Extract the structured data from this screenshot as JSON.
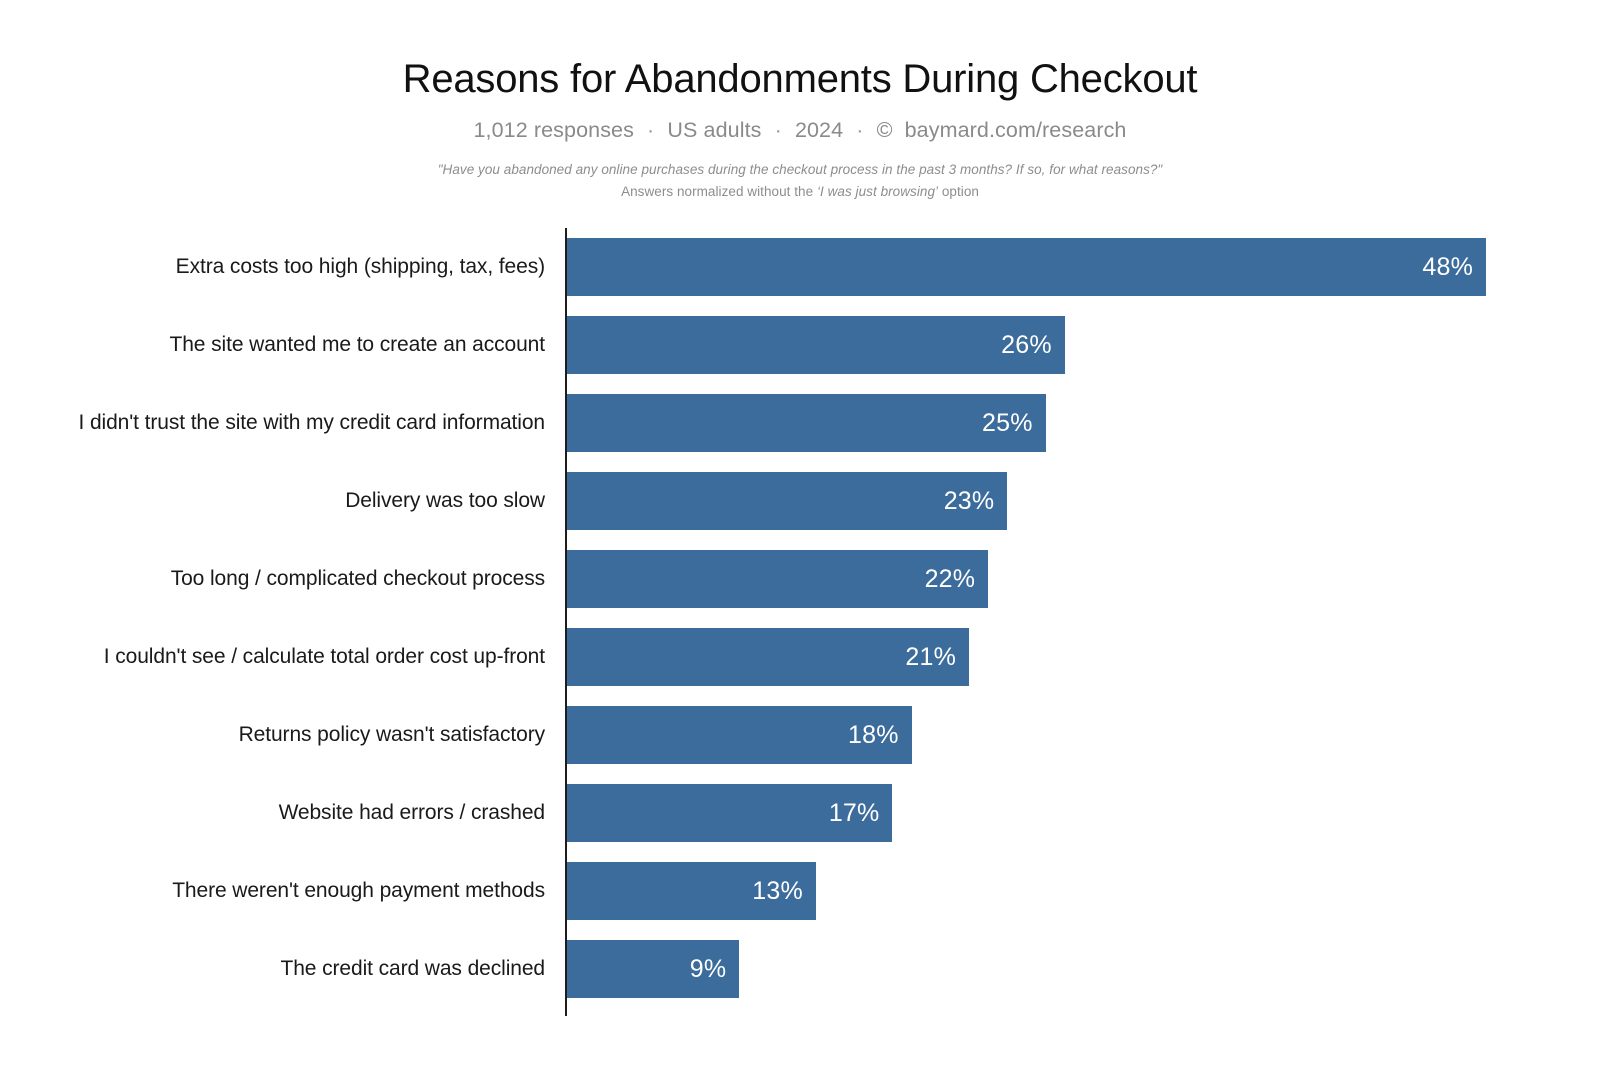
{
  "header": {
    "title": "Reasons for Abandonments During Checkout",
    "responses": "1,012 responses",
    "audience": "US adults",
    "year": "2024",
    "copyright_symbol": "©",
    "source": "baymard.com/research",
    "separator": "·",
    "question": "\"Have you abandoned any online purchases during the checkout process in the past 3 months? If so, for what reasons?\"",
    "note_prefix": "Answers normalized without the ",
    "note_emphasis": "‘I was just browsing’",
    "note_suffix": " option"
  },
  "colors": {
    "bar": "#3b6c9c",
    "bar_value_text": "#ffffff",
    "category_text": "#1a1a1a",
    "subtitle_text": "#8a8a8a",
    "axis": "#1d1d1d",
    "background": "#ffffff"
  },
  "chart_data": {
    "type": "bar",
    "orientation": "horizontal",
    "title": "Reasons for Abandonments During Checkout",
    "subtitle": "1,012 responses · US adults · 2024 · © baymard.com/research",
    "xlabel": "",
    "ylabel": "",
    "xlim": [
      0,
      48
    ],
    "grid": false,
    "legend": null,
    "value_suffix": "%",
    "categories": [
      "Extra costs too high (shipping, tax, fees)",
      "The site wanted me to create an account",
      "I didn't trust the site with my credit card information",
      "Delivery was too slow",
      "Too long / complicated checkout process",
      "I couldn't see / calculate total order cost up-front",
      "Returns policy wasn't satisfactory",
      "Website had errors / crashed",
      "There weren't enough payment methods",
      "The credit card was declined"
    ],
    "values": [
      48,
      26,
      25,
      23,
      22,
      21,
      18,
      17,
      13,
      9
    ],
    "value_labels": [
      "48%",
      "26%",
      "25%",
      "23%",
      "22%",
      "21%",
      "18%",
      "17%",
      "13%",
      "9%"
    ]
  },
  "bars": [
    {
      "label": "Extra costs too high (shipping, tax, fees)",
      "value": 48,
      "value_label": "48%"
    },
    {
      "label": "The site wanted me to create an account",
      "value": 26,
      "value_label": "26%"
    },
    {
      "label": "I didn't trust the site with my credit card information",
      "value": 25,
      "value_label": "25%"
    },
    {
      "label": "Delivery was too slow",
      "value": 23,
      "value_label": "23%"
    },
    {
      "label": "Too long / complicated checkout process",
      "value": 22,
      "value_label": "22%"
    },
    {
      "label": "I couldn't see / calculate total order cost up-front",
      "value": 21,
      "value_label": "21%"
    },
    {
      "label": "Returns policy wasn't satisfactory",
      "value": 18,
      "value_label": "18%"
    },
    {
      "label": "Website had errors / crashed",
      "value": 17,
      "value_label": "17%"
    },
    {
      "label": "There weren't enough payment methods",
      "value": 13,
      "value_label": "13%"
    },
    {
      "label": "The credit card was declined",
      "value": 9,
      "value_label": "9%"
    }
  ]
}
